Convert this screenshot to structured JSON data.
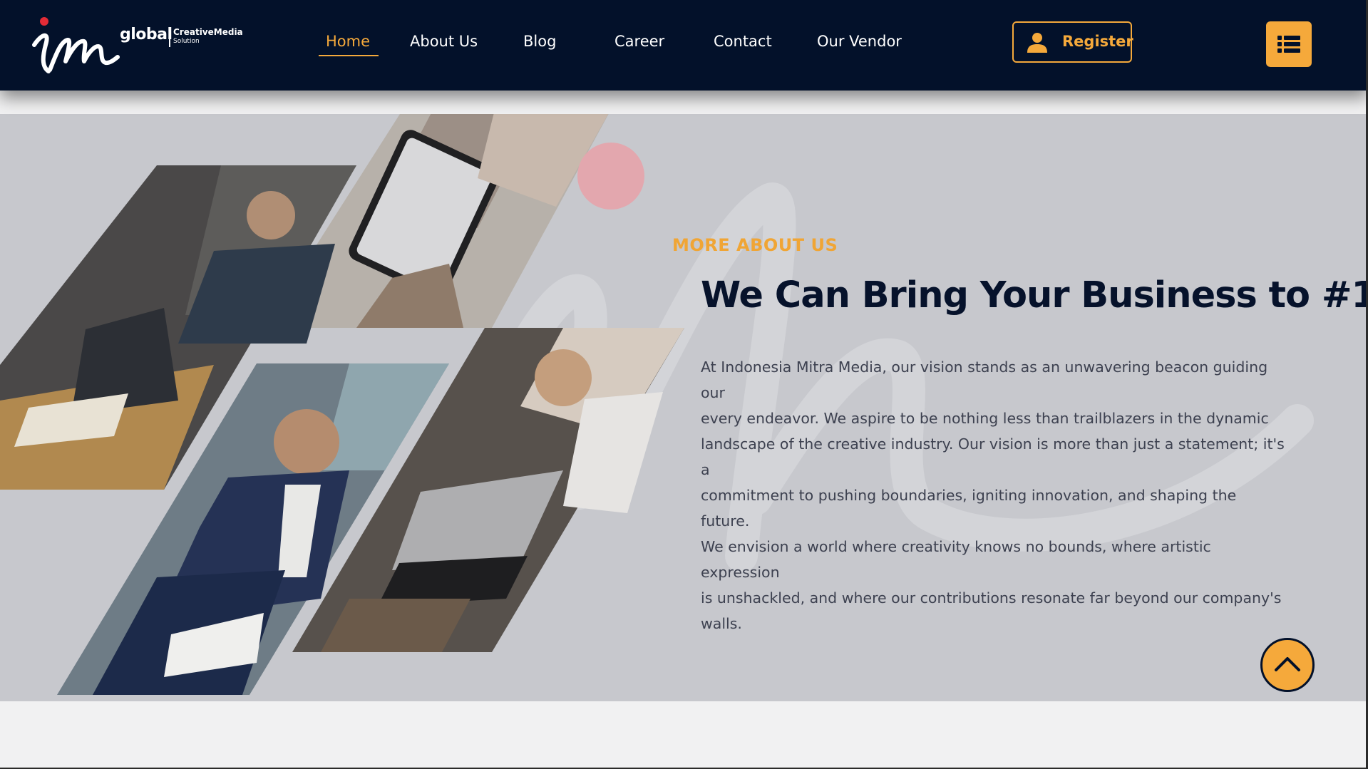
{
  "header": {
    "logo": {
      "word": "global",
      "brand": "CreativeMedia",
      "sub": "Solution"
    },
    "nav": [
      {
        "label": "Home",
        "active": true
      },
      {
        "label": "About Us",
        "active": false
      },
      {
        "label": "Blog",
        "active": false
      },
      {
        "label": "Career",
        "active": false
      },
      {
        "label": "Contact",
        "active": false
      },
      {
        "label": "Our Vendor",
        "active": false
      }
    ],
    "register_label": "Register",
    "icons": {
      "register": "user-icon",
      "menu": "list-icon"
    }
  },
  "about": {
    "tag": "MORE ABOUT US",
    "heading": "We Can Bring Your Business to #1",
    "body_lines": [
      "At Indonesia Mitra Media, our vision stands as an unwavering beacon guiding our",
      "every endeavor. We aspire to be nothing less than trailblazers in the dynamic",
      "landscape of the creative industry. Our vision is more than just a statement; it's a",
      "commitment to pushing boundaries, igniting innovation, and shaping the future.",
      "We envision a world where creativity knows no bounds, where artistic expression",
      "is unshackled, and where our contributions resonate far beyond our company's",
      "walls."
    ]
  },
  "scroll_top_icon": "chevron-up-icon",
  "colors": {
    "navy": "#03112a",
    "accent": "#f5a93b",
    "section_bg": "#c7c8cd",
    "page_bg": "#f1f1f2"
  }
}
